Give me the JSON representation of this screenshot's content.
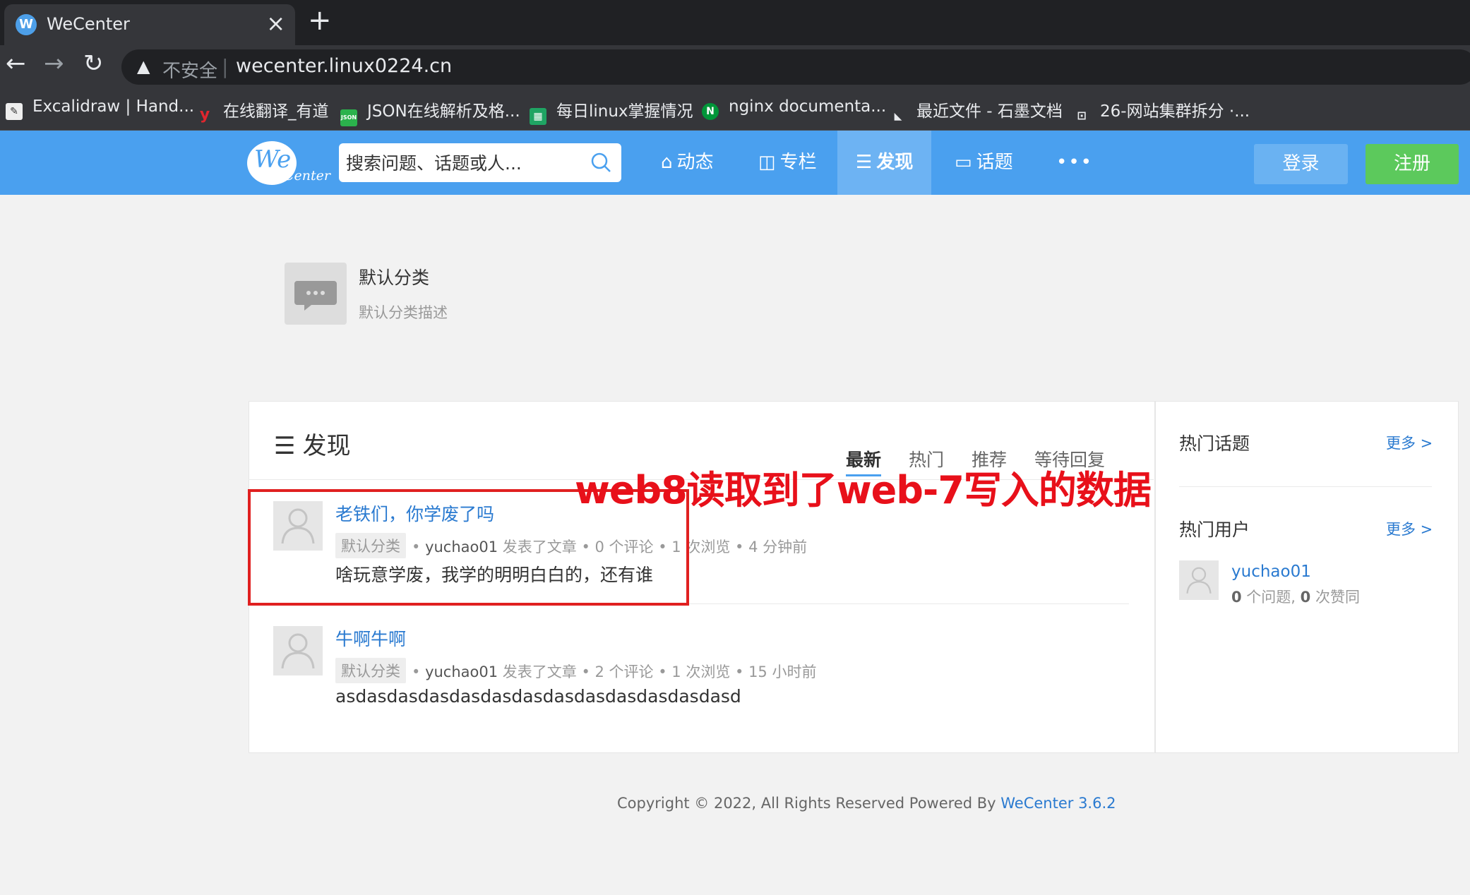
{
  "browser": {
    "tab_title": "WeCenter",
    "tab_favicon": "W",
    "address_warning": "不安全",
    "url": "wecenter.linux0224.cn",
    "bookmarks": [
      {
        "label": "Excalidraw | Hand...",
        "icon": "excalidraw-icon"
      },
      {
        "label": "在线翻译_有道",
        "icon": "youdao-icon"
      },
      {
        "label": "JSON在线解析及格...",
        "icon": "json-icon"
      },
      {
        "label": "每日linux掌握情况",
        "icon": "sheet-icon"
      },
      {
        "label": "nginx documenta...",
        "icon": "nginx-icon"
      },
      {
        "label": "最近文件 - 石墨文档",
        "icon": "shimo-icon"
      },
      {
        "label": "26-网站集群拆分 ·...",
        "icon": "docs-icon"
      }
    ]
  },
  "header": {
    "logo_we": "We",
    "logo_center": "Center",
    "search_placeholder": "搜索问题、话题或人...",
    "nav": [
      {
        "label": "动态",
        "icon": "home-icon"
      },
      {
        "label": "专栏",
        "icon": "columns-icon"
      },
      {
        "label": "发现",
        "icon": "list-icon",
        "active": true
      },
      {
        "label": "话题",
        "icon": "chat-icon"
      },
      {
        "label": "•••",
        "icon": "more-icon"
      }
    ],
    "login": "登录",
    "register": "注册"
  },
  "category": {
    "name": "默认分类",
    "description": "默认分类描述"
  },
  "main": {
    "section_title": "发现",
    "tabs": [
      "最新",
      "热门",
      "推荐",
      "等待回复"
    ],
    "posts": [
      {
        "title": "老铁们，你学废了吗",
        "tag": "默认分类",
        "user": "yuchao01",
        "meta": "发表了文章 • 0 个评论 • 1 次浏览 • 4 分钟前",
        "excerpt": "啥玩意学废，我学的明明白白的，还有谁"
      },
      {
        "title": "牛啊牛啊",
        "tag": "默认分类",
        "user": "yuchao01",
        "meta": "发表了文章 • 2 个评论 • 1 次浏览 • 15 小时前",
        "excerpt": "asdasdasdasdasdasdasdasdasdasdasdasdasd"
      }
    ]
  },
  "sidebar": {
    "hot_topics": "热门话题",
    "hot_users": "热门用户",
    "more": "更多 >",
    "user": {
      "name": "yuchao01",
      "questions": "0",
      "questions_label": " 个问题, ",
      "likes": "0",
      "likes_label": " 次赞同"
    }
  },
  "annotation": "web8读取到了web-7写入的数据",
  "footer": {
    "text": "Copyright © 2022, All Rights Reserved Powered By ",
    "brand": "WeCenter 3.6.2"
  },
  "colors": {
    "header_blue": "#4aa0ef",
    "register_green": "#5cc95c",
    "link_blue": "#2a7ad0",
    "annotation_red": "#e8101a"
  }
}
